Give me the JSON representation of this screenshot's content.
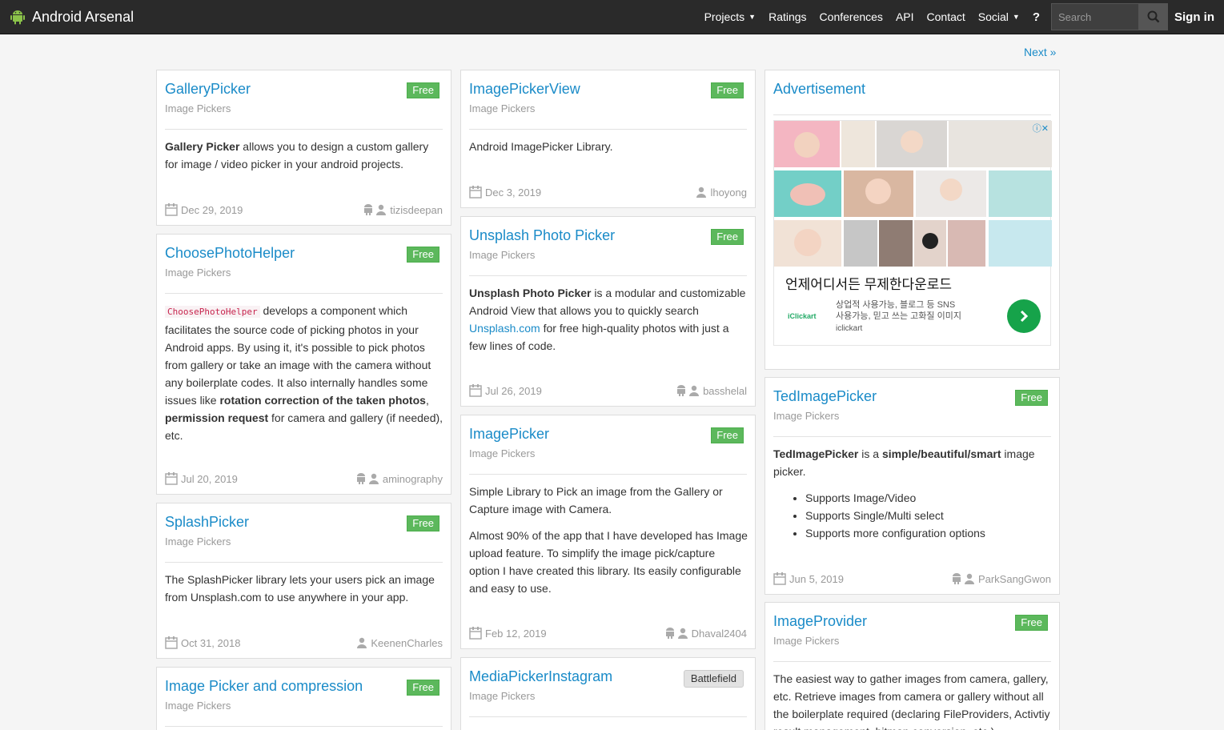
{
  "app": {
    "brand": "Android Arsenal"
  },
  "nav": {
    "projects": "Projects",
    "ratings": "Ratings",
    "conferences": "Conferences",
    "api": "API",
    "contact": "Contact",
    "social": "Social",
    "help": "?",
    "search_placeholder": "Search",
    "signin": "Sign in"
  },
  "pagination": {
    "next": "Next »"
  },
  "cards": [
    {
      "title": "GalleryPicker",
      "category": "Image Pickers",
      "badge": "Free",
      "bold": "Gallery Picker",
      "text": " allows you to design a custom gallery for image / video picker in your android projects.",
      "date": "Dec 29, 2019",
      "author": "tizisdeepan"
    },
    {
      "title": "ChoosePhotoHelper",
      "category": "Image Pickers",
      "badge": "Free",
      "code": "ChoosePhotoHelper",
      "t1": " develops a component which facilitates the source code of picking photos in your Android apps. By using it, it's possible to pick photos from gallery or take an image with the camera without any boilerplate codes. It also internally handles some issues like ",
      "b1": "rotation correction of the taken photos",
      "t2": ", ",
      "b2": "permission request",
      "t3": " for camera and gallery (if needed), etc.",
      "date": "Jul 20, 2019",
      "author": "aminography"
    },
    {
      "title": "SplashPicker",
      "category": "Image Pickers",
      "badge": "Free",
      "text": "The SplashPicker library lets your users pick an image from Unsplash.com to use anywhere in your app.",
      "date": "Oct 31, 2018",
      "author": "KeenenCharles"
    },
    {
      "title": "Image Picker and compression",
      "category": "Image Pickers",
      "badge": "Free"
    },
    {
      "title": "ImagePickerView",
      "category": "Image Pickers",
      "badge": "Free",
      "text": "Android ImagePicker Library.",
      "date": "Dec 3, 2019",
      "author": "lhoyong"
    },
    {
      "title": "Unsplash Photo Picker",
      "category": "Image Pickers",
      "badge": "Free",
      "bold": "Unsplash Photo Picker",
      "t1": " is a modular and customizable Android View that allows you to quickly search ",
      "link": "Unsplash.com",
      "t2": " for free high-quality photos with just a few lines of code.",
      "date": "Jul 26, 2019",
      "author": "basshelal"
    },
    {
      "title": "ImagePicker",
      "category": "Image Pickers",
      "badge": "Free",
      "p1": "Simple Library to Pick an image from the Gallery or Capture image with Camera.",
      "p2": "Almost 90% of the app that I have developed has Image upload feature. To simplify the image pick/capture option I have created this library. Its easily configurable and easy to use.",
      "date": "Feb 12, 2019",
      "author": "Dhaval2404"
    },
    {
      "title": "MediaPickerInstagram",
      "category": "Image Pickers",
      "badge": "Battlefield"
    },
    {
      "title": "TedImagePicker",
      "category": "Image Pickers",
      "badge": "Free",
      "b1": "TedImagePicker",
      "t1": " is a ",
      "b2": "simple/beautiful/smart",
      "t2": " image picker.",
      "items": [
        "Supports Image/Video",
        "Supports Single/Multi select",
        "Supports more configuration options"
      ],
      "date": "Jun 5, 2019",
      "author": "ParkSangGwon"
    },
    {
      "title": "ImageProvider",
      "category": "Image Pickers",
      "badge": "Free",
      "text": "The easiest way to gather images from camera, gallery, etc. Retrieve images from camera or gallery without all the boilerplate required (declaring FileProviders, Activtiy result management, bitmap conversion, etc.)"
    }
  ],
  "ad": {
    "title": "Advertisement",
    "headline": "언제어디서든 무제한다운로드",
    "desc1": "상업적 사용가능, 블로그 등 SNS",
    "desc2": "사용가능, 믿고 쓰는 고화질 이미지",
    "sponsor": "iclickart",
    "logo": "iClickart"
  }
}
